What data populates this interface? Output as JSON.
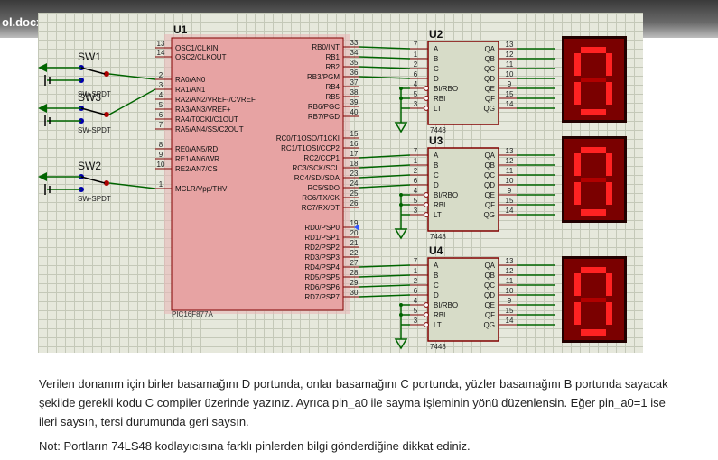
{
  "window": {
    "title": "ol.docx"
  },
  "schematic": {
    "u1": {
      "ref": "U1",
      "part": "PIC16F877A",
      "left_pins": [
        {
          "num": "13",
          "name": "OSC1/CLKIN"
        },
        {
          "num": "14",
          "name": "OSC2/CLKOUT"
        },
        {
          "num": "2",
          "name": "RA0/AN0"
        },
        {
          "num": "3",
          "name": "RA1/AN1"
        },
        {
          "num": "4",
          "name": "RA2/AN2/VREF-/CVREF"
        },
        {
          "num": "5",
          "name": "RA3/AN3/VREF+"
        },
        {
          "num": "6",
          "name": "RA4/T0CKI/C1OUT"
        },
        {
          "num": "7",
          "name": "RA5/AN4/SS/C2OUT"
        },
        {
          "num": "8",
          "name": "RE0/AN5/RD"
        },
        {
          "num": "9",
          "name": "RE1/AN6/WR"
        },
        {
          "num": "10",
          "name": "RE2/AN7/CS"
        },
        {
          "num": "1",
          "name": "MCLR/Vpp/THV"
        }
      ],
      "right_pins": [
        {
          "num": "33",
          "name": "RB0/INT"
        },
        {
          "num": "34",
          "name": "RB1"
        },
        {
          "num": "35",
          "name": "RB2"
        },
        {
          "num": "36",
          "name": "RB3/PGM"
        },
        {
          "num": "37",
          "name": "RB4"
        },
        {
          "num": "38",
          "name": "RB5"
        },
        {
          "num": "39",
          "name": "RB6/PGC"
        },
        {
          "num": "40",
          "name": "RB7/PGD"
        },
        {
          "num": "15",
          "name": "RC0/T1OSO/T1CKI"
        },
        {
          "num": "16",
          "name": "RC1/T1OSI/CCP2"
        },
        {
          "num": "17",
          "name": "RC2/CCP1"
        },
        {
          "num": "18",
          "name": "RC3/SCK/SCL"
        },
        {
          "num": "23",
          "name": "RC4/SDI/SDA"
        },
        {
          "num": "24",
          "name": "RC5/SDO"
        },
        {
          "num": "25",
          "name": "RC6/TX/CK"
        },
        {
          "num": "26",
          "name": "RC7/RX/DT"
        },
        {
          "num": "19",
          "name": "RD0/PSP0"
        },
        {
          "num": "20",
          "name": "RD1/PSP1"
        },
        {
          "num": "21",
          "name": "RD2/PSP2"
        },
        {
          "num": "22",
          "name": "RD3/PSP3"
        },
        {
          "num": "27",
          "name": "RD4/PSP4"
        },
        {
          "num": "28",
          "name": "RD5/PSP5"
        },
        {
          "num": "29",
          "name": "RD6/PSP6"
        },
        {
          "num": "30",
          "name": "RD7/PSP7"
        }
      ]
    },
    "decoders": [
      {
        "ref": "U2",
        "part": "7448"
      },
      {
        "ref": "U3",
        "part": "7448"
      },
      {
        "ref": "U4",
        "part": "7448"
      }
    ],
    "decoder_left_pins": [
      {
        "num": "7",
        "name": "A"
      },
      {
        "num": "1",
        "name": "B"
      },
      {
        "num": "2",
        "name": "C"
      },
      {
        "num": "6",
        "name": "D"
      },
      {
        "num": "4",
        "name": "BI/RBO"
      },
      {
        "num": "5",
        "name": "RBI"
      },
      {
        "num": "3",
        "name": "LT"
      }
    ],
    "decoder_right_pins": [
      {
        "num": "13",
        "name": "QA"
      },
      {
        "num": "12",
        "name": "QB"
      },
      {
        "num": "11",
        "name": "QC"
      },
      {
        "num": "10",
        "name": "QD"
      },
      {
        "num": "9",
        "name": "QE"
      },
      {
        "num": "15",
        "name": "QF"
      },
      {
        "num": "14",
        "name": "QG"
      }
    ],
    "switches": [
      {
        "ref": "SW1",
        "part": "SW-SPDT"
      },
      {
        "ref": "SW3",
        "part": "SW-SPDT"
      },
      {
        "ref": "SW2",
        "part": "SW-SPDT"
      }
    ],
    "displays": [
      {
        "digit": "0"
      },
      {
        "digit": "0"
      },
      {
        "digit": "0"
      }
    ]
  },
  "content": {
    "paragraph1": "Verilen donanım için birler basamağını D portunda, onlar basamağını C portunda, yüzler basamağını B portunda sayacak şekilde gerekli kodu C compiler üzerinde yazınız. Ayrıca pin_a0 ile sayma işleminin yönü düzenlensin. Eğer pin_a0=1 ise ileri saysın, tersi durumunda geri saysın.",
    "paragraph2": "Not: Portların 74LS48 kodlayıcısına farklı pinlerden bilgi gönderdiğine dikkat ediniz."
  },
  "colors": {
    "wire": "#006400",
    "body": "#e7a3a3",
    "border": "#800000",
    "segment": "#ff2222",
    "display_bg": "#7a0000"
  }
}
